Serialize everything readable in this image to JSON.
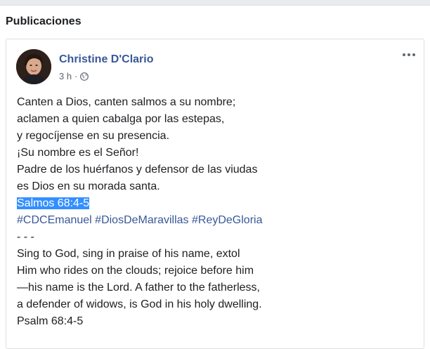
{
  "section": {
    "title": "Publicaciones"
  },
  "post": {
    "author": "Christine D'Clario",
    "time": "3 h",
    "separator": "·",
    "privacy_icon": "globe-icon",
    "more_icon": "more-options-icon",
    "spanish_lines": [
      "Canten a Dios, canten salmos a su nombre;",
      "aclamen a quien cabalga por las estepas,",
      "y regocíjense en su presencia.",
      "¡Su nombre es el Señor!",
      "Padre de los huérfanos y defensor de las viudas",
      "es Dios en su morada santa."
    ],
    "reference_highlighted": "Salmos 68:4-5",
    "hashtags": [
      "#CDCEmanuel",
      "#DiosDeMaravillas",
      "#ReyDeGloria"
    ],
    "divider": "- - -",
    "english_lines": [
      "Sing to God, sing in praise of his name, extol",
      "Him who rides on the clouds; rejoice before him",
      "—his name is the Lord. A father to the fatherless,",
      "a defender of widows, is God in his holy dwelling.",
      "Psalm 68:4-5"
    ]
  },
  "colors": {
    "link": "#385898",
    "highlight": "#338fff",
    "meta": "#606770"
  }
}
